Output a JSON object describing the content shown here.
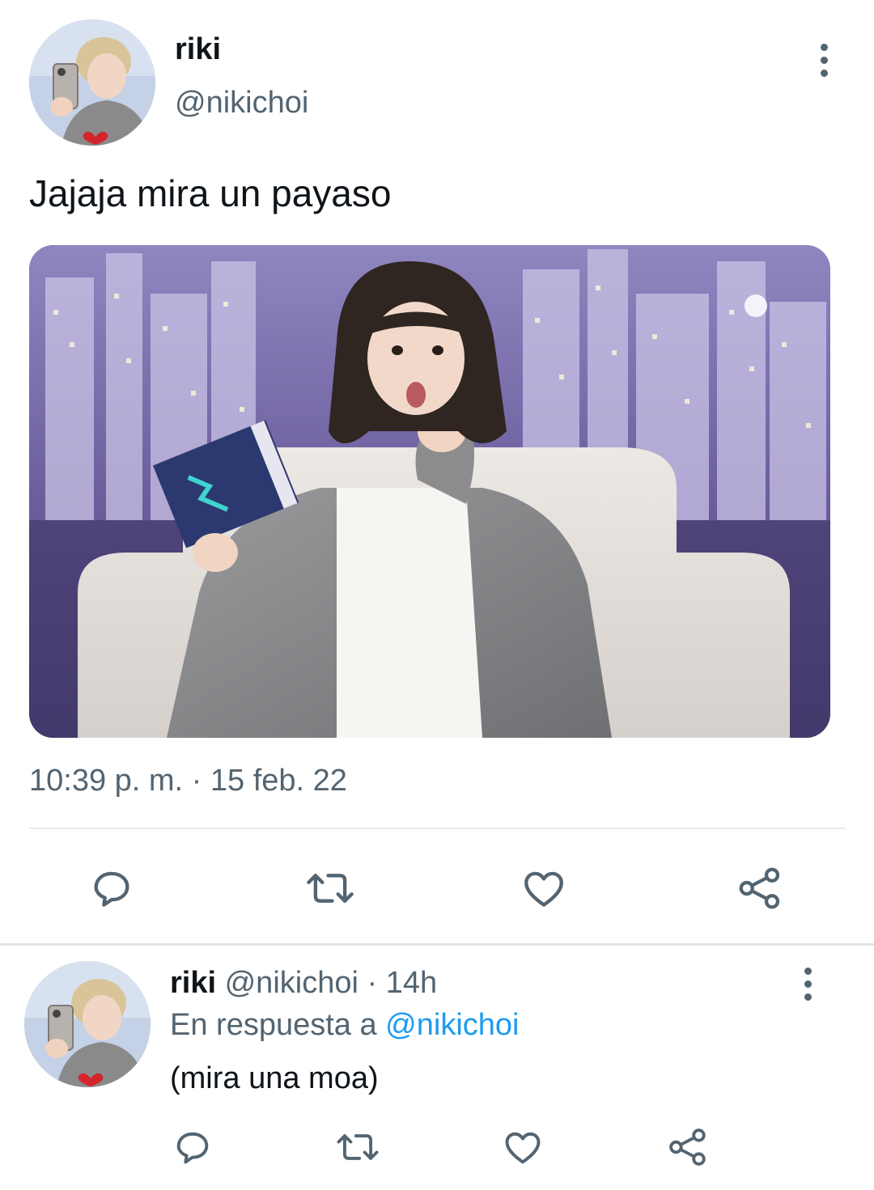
{
  "tweet": {
    "author_name": "riki",
    "author_handle": "@nikichoi",
    "text": "Jajaja mira un payaso",
    "timestamp": "10:39 p. m. · 15 feb. 22",
    "media_description": "photo",
    "actions": [
      "reply-icon",
      "retweet-icon",
      "like-icon",
      "share-icon"
    ]
  },
  "reply": {
    "author_name": "riki",
    "author_handle": "@nikichoi",
    "separator": "·",
    "time": "14h",
    "replying_to_prefix": "En respuesta a",
    "replying_to_handle": "@nikichoi",
    "text": "(mira una moa)",
    "actions": [
      "reply-icon",
      "retweet-icon",
      "like-icon",
      "share-icon"
    ]
  },
  "colors": {
    "text_primary": "#0f1419",
    "text_secondary": "#536471",
    "link": "#1d9bf0",
    "divider": "#e6e9ec"
  }
}
